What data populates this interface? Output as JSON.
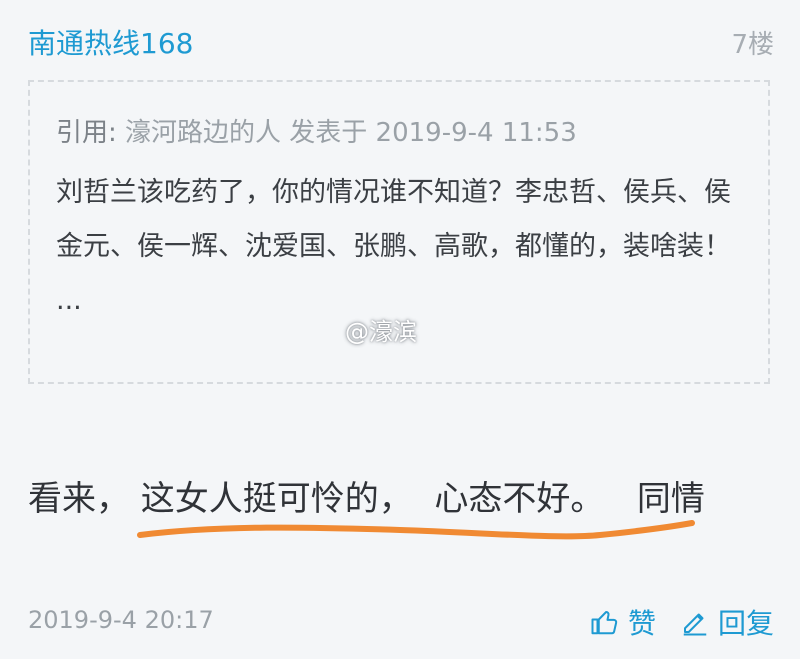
{
  "post": {
    "username": "南通热线168",
    "floor": "7楼",
    "quote": {
      "label": "引用:",
      "meta": "濠河路边的人 发表于 2019-9-4 11:53",
      "body": "刘哲兰该吃药了，你的情况谁不知道？李忠哲、侯兵、侯金元、侯一辉、沈爱国、张鹏、高歌，都懂的，装啥装！ ..."
    },
    "watermark": "@濠滨",
    "content": "看来， 这女人挺可怜的，  心态不好。   同情",
    "timestamp": "2019-9-4 20:17",
    "actions": {
      "like_label": "赞",
      "reply_label": "回复"
    }
  },
  "colors": {
    "accent": "#1e9ad2",
    "underline": "#f08a33"
  }
}
